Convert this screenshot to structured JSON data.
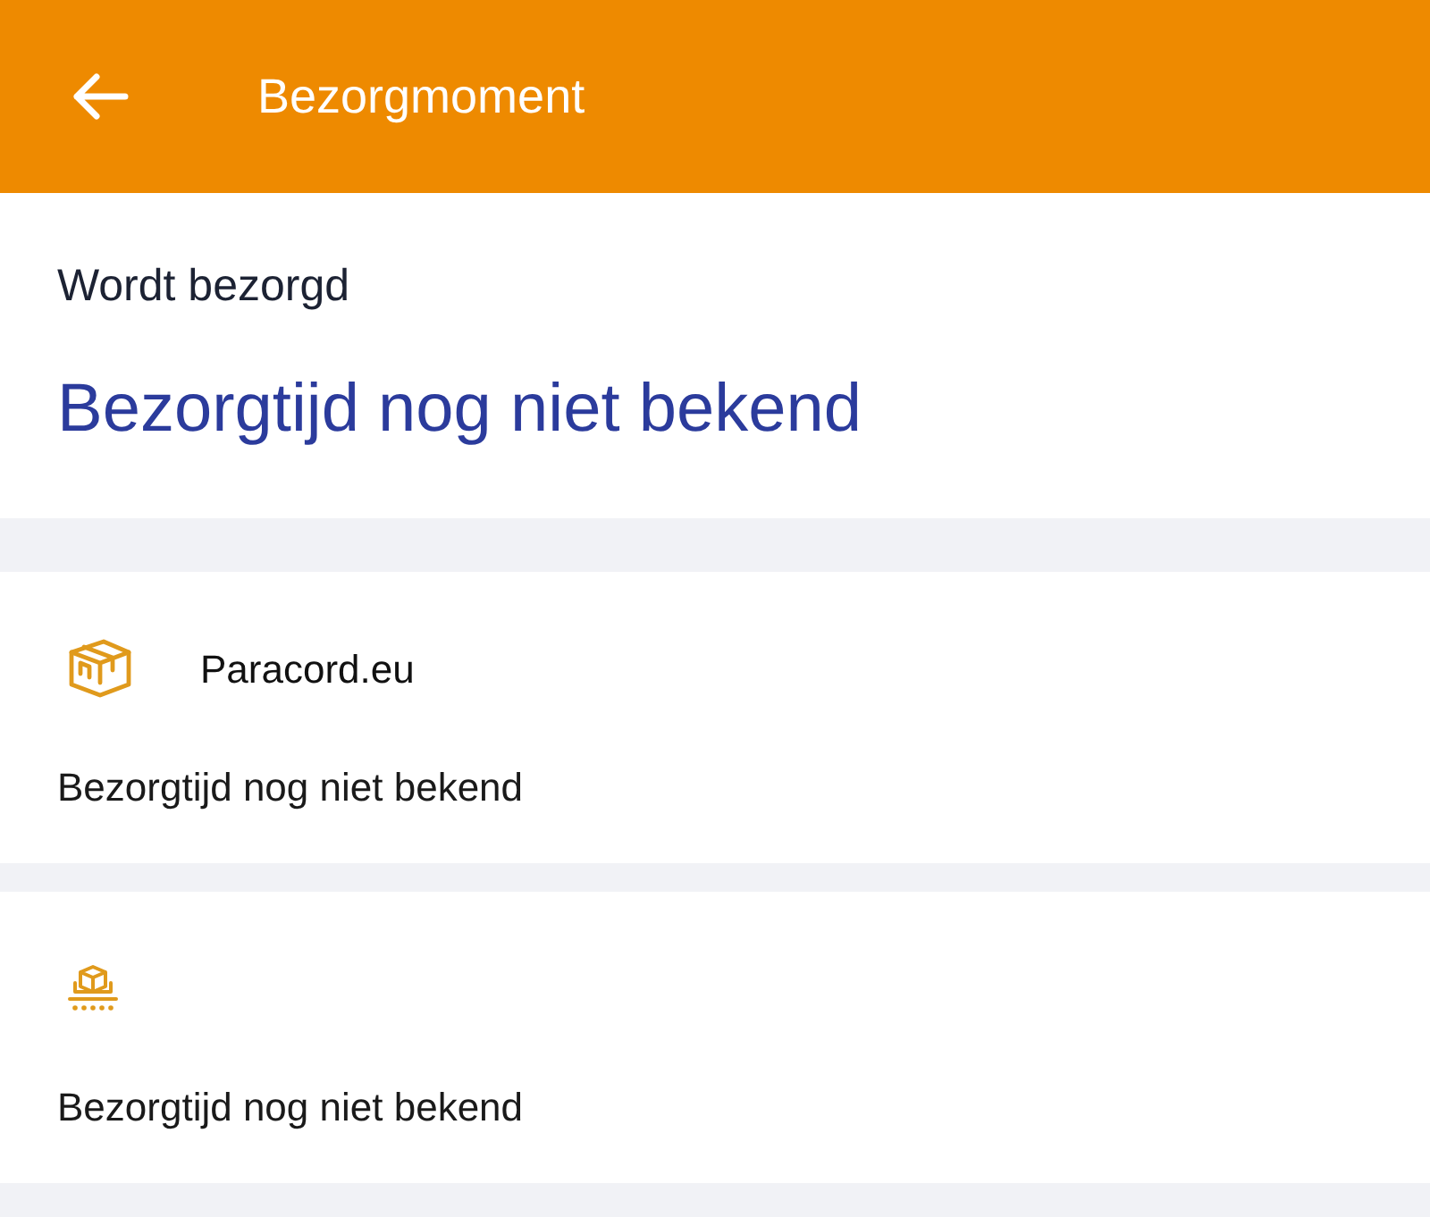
{
  "header": {
    "title": "Bezorgmoment"
  },
  "status": {
    "label": "Wordt bezorgd",
    "headline": "Bezorgtijd nog niet bekend"
  },
  "shipments": [
    {
      "kind": "box",
      "sender": "Paracord.eu",
      "delivery_time": "Bezorgtijd nog niet bekend"
    },
    {
      "kind": "conveyor",
      "delivery_time": "Bezorgtijd nog niet bekend"
    }
  ]
}
